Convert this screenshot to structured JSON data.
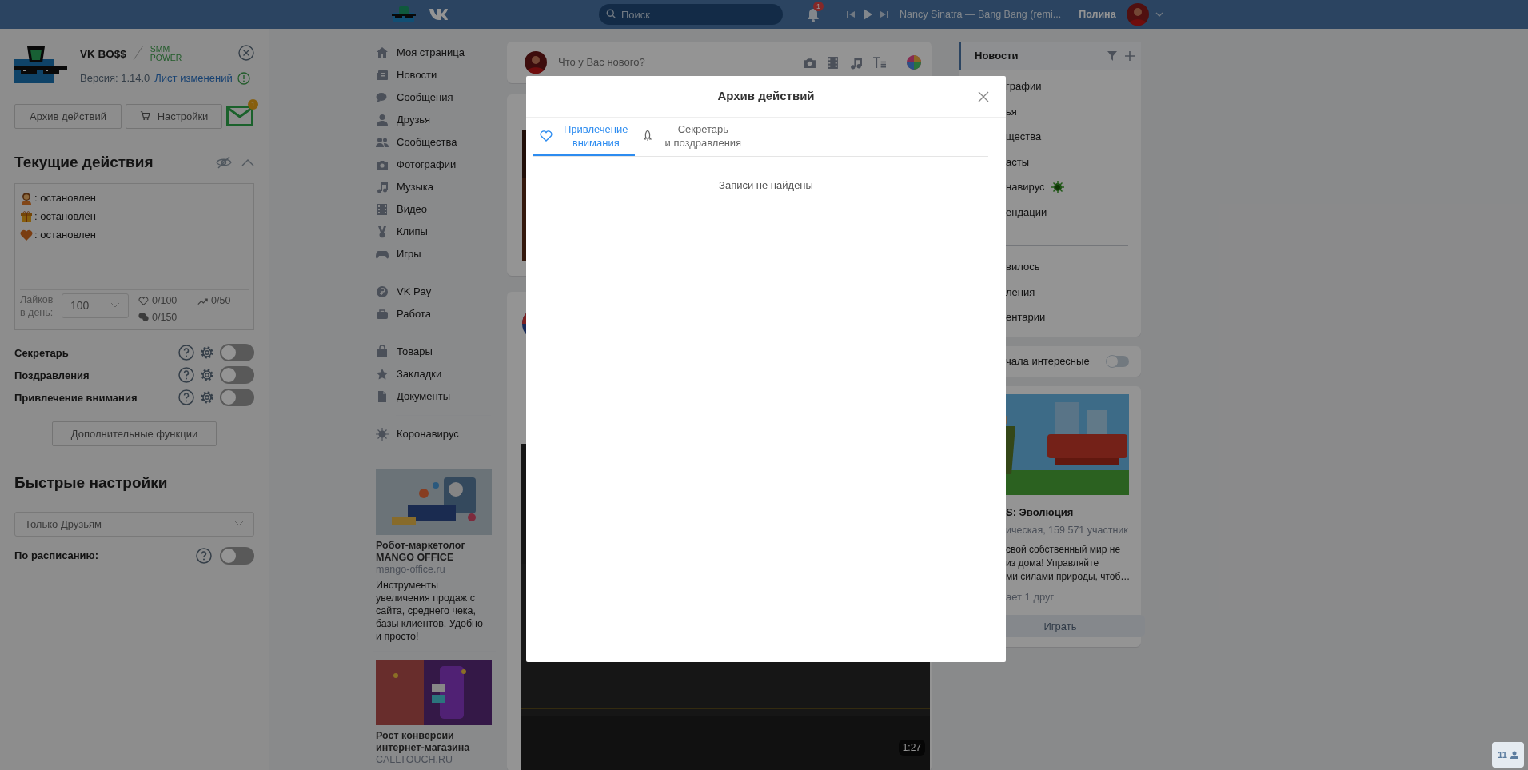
{
  "topbar": {
    "search": {
      "placeholder": "Поиск"
    },
    "notifications_badge": "1",
    "player": {
      "track": "Nancy Sinatra — Bang Bang (remi..."
    },
    "user": "Полина"
  },
  "extension": {
    "title": "VK BO$$",
    "tagline": "SMM POWER",
    "version": "Версия: 1.14.0",
    "changelog_link": "Лист изменений",
    "buttons": [
      {
        "label": "Архив действий",
        "kind": "plain"
      },
      {
        "label": "Настройки",
        "kind": "cart"
      }
    ],
    "mail_badge": "1",
    "current_actions": {
      "title": "Текущие действия",
      "actions": [
        {
          "kind": "person",
          "status": ": остановлен"
        },
        {
          "kind": "gift",
          "status": ": остановлен"
        },
        {
          "kind": "heart",
          "status": ": остановлен"
        }
      ],
      "likes_label": "Лайков в день:",
      "likes_select": "100",
      "stats": [
        {
          "kind": "heart",
          "value": "0/100"
        },
        {
          "kind": "trend",
          "value": "0/50"
        },
        {
          "kind": "comment",
          "value": "0/150"
        }
      ]
    },
    "features": [
      {
        "label": "Секретарь",
        "on": false
      },
      {
        "label": "Поздравления",
        "on": false
      },
      {
        "label": "Привлечение внимания",
        "on": false
      }
    ],
    "more_button": "Дополнительные функции",
    "quick_settings": {
      "title": "Быстрые настройки",
      "audience": "Только Друзьям",
      "schedule": {
        "label": "По расписанию:",
        "on": false
      }
    }
  },
  "nav": {
    "groups": [
      {
        "items": [
          {
            "label": "Моя страница"
          },
          {
            "label": "Новости"
          },
          {
            "label": "Сообщения"
          },
          {
            "label": "Друзья"
          },
          {
            "label": "Сообщества"
          },
          {
            "label": "Фотографии"
          },
          {
            "label": "Музыка"
          },
          {
            "label": "Видео"
          },
          {
            "label": "Клипы"
          },
          {
            "label": "Игры"
          }
        ]
      },
      {
        "items": [
          {
            "label": "VK Pay"
          },
          {
            "label": "Работа"
          }
        ]
      },
      {
        "items": [
          {
            "label": "Товары"
          },
          {
            "label": "Закладки"
          },
          {
            "label": "Документы"
          }
        ]
      },
      {
        "items": [
          {
            "label": "Коронавирус"
          }
        ]
      }
    ]
  },
  "nav_ads": [
    {
      "kind": "picture",
      "title": "Робот-маркетолог MANGO OFFICE",
      "domain": "mango-office.ru",
      "text": "Инструменты увеличения продаж с сайта, среднего чека, базы клиентов. Удобно и просто!"
    },
    {
      "kind": "picture",
      "title": "Рост конверсии интернет-магазина",
      "domain": "CALLTOUCH.RU"
    }
  ],
  "feed": {
    "composer": {
      "placeholder": "Что у Вас нового?"
    },
    "video": {
      "duration": "1:27"
    }
  },
  "news_menu": {
    "items": [
      {
        "label": "Новости",
        "selected": true
      },
      {
        "label": "графии",
        "selected": false
      },
      {
        "label": "ья",
        "selected": false
      },
      {
        "label": "щества",
        "selected": false
      },
      {
        "label": "асты",
        "selected": false
      },
      {
        "label": "навирус",
        "selected": false,
        "kind": "virus"
      },
      {
        "label": "ендации",
        "selected": false
      }
    ],
    "secondary_items": [
      {
        "label": "вилось"
      },
      {
        "label": "ления"
      },
      {
        "label": "ентарии"
      }
    ]
  },
  "interesting_first": {
    "label": "чала интересные",
    "on": false
  },
  "game_ad": {
    "title": "S: Эволюция",
    "meta": "ическая, 159 571 участник",
    "lines": [
      "свой собственный мир не",
      "из дома! Управляйте",
      "ми силами природы, чтоб…"
    ],
    "friends": "ает 1 друг",
    "button": "Играть"
  },
  "modal": {
    "title": "Архив действий",
    "tabs": [
      {
        "lines": [
          "Привлечение",
          "внимания"
        ],
        "kind": "heart",
        "selected": true
      },
      {
        "lines": [
          "Секретарь",
          "и поздравления"
        ],
        "kind": "rocket",
        "selected": false
      }
    ],
    "empty_text": "Записи не найдены"
  },
  "online_widget": {
    "count": "11"
  }
}
